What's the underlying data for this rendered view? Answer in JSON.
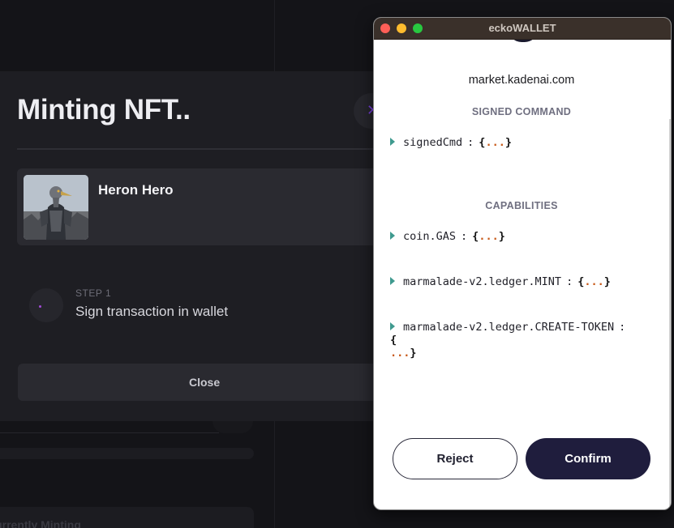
{
  "background": {
    "currently_minting_label": "Currently Minting"
  },
  "modal": {
    "title": "Minting NFT..",
    "close_icon_glyph": "✕",
    "nft": {
      "name": "Heron Hero",
      "image_icon": "heron-hero-image"
    },
    "step": {
      "label": "STEP 1",
      "text": "Sign transaction in wallet"
    },
    "close_label": "Close",
    "accent_color": "#7b3fe4"
  },
  "wallet": {
    "window_title": "eckoWALLET",
    "origin": "market.kadenai.com",
    "signed_command": {
      "heading": "SIGNED COMMAND",
      "key": "signedCmd",
      "value_open": "{",
      "ellipsis": "...",
      "value_close": "}"
    },
    "capabilities": {
      "heading": "CAPABILITIES",
      "items": [
        {
          "key": "coin.GAS",
          "open": "{",
          "ellipsis": "...",
          "close": "}"
        },
        {
          "key": "marmalade-v2.ledger.MINT",
          "open": "{",
          "ellipsis": "...",
          "close": "}"
        },
        {
          "key": "marmalade-v2.ledger.CREATE-TOKEN",
          "open": "{",
          "ellipsis": "...",
          "close": "}"
        }
      ]
    },
    "reject_label": "Reject",
    "confirm_label": "Confirm",
    "colors": {
      "confirm_bg": "#1f1d3d",
      "caret": "#3f9a8f",
      "ellipsis": "#c85a1a"
    }
  }
}
